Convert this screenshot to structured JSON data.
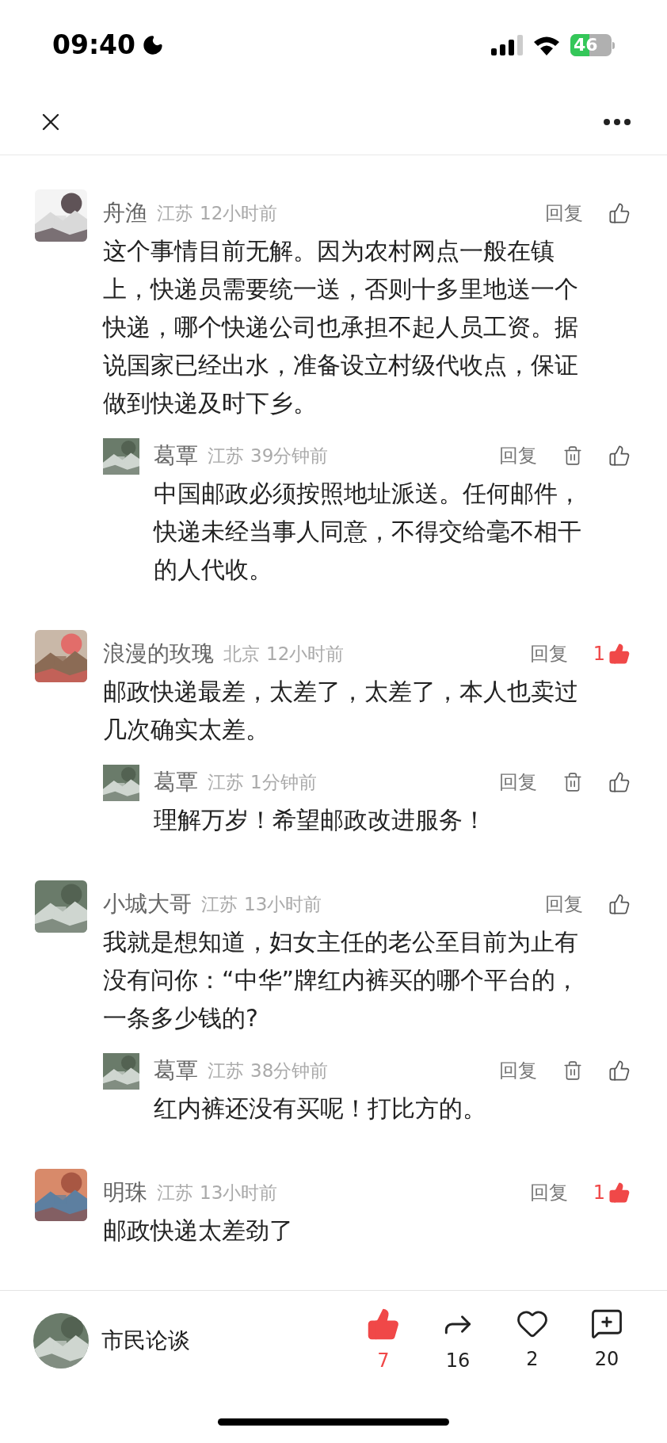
{
  "status_bar": {
    "time": "09:40",
    "battery": "46"
  },
  "comments": [
    {
      "name": "舟渔",
      "location": "江苏",
      "time": "12小时前",
      "reply_label": "回复",
      "deletable": false,
      "like": {
        "liked": false
      },
      "text": "这个事情目前无解。因为农村网点一般在镇上，快递员需要统一送，否则十多里地送一个快递，哪个快递公司也承担不起人员工资。据说国家已经出水，准备设立村级代收点，保证做到快递及时下乡。",
      "replies": [
        {
          "name": "葛覃",
          "location": "江苏",
          "time": "39分钟前",
          "reply_label": "回复",
          "deletable": true,
          "like": {
            "liked": false
          },
          "text": "中国邮政必须按照地址派送。任何邮件，快递未经当事人同意，不得交给毫不相干的人代收。"
        }
      ]
    },
    {
      "name": "浪漫的玫瑰",
      "location": "北京",
      "time": "12小时前",
      "reply_label": "回复",
      "deletable": false,
      "like": {
        "liked": true,
        "count": "1"
      },
      "text": "邮政快递最差，太差了，太差了，本人也卖过几次确实太差。",
      "replies": [
        {
          "name": "葛覃",
          "location": "江苏",
          "time": "1分钟前",
          "reply_label": "回复",
          "deletable": true,
          "like": {
            "liked": false
          },
          "text": "理解万岁！希望邮政改进服务！"
        }
      ]
    },
    {
      "name": "小城大哥",
      "location": "江苏",
      "time": "13小时前",
      "reply_label": "回复",
      "deletable": false,
      "like": {
        "liked": false
      },
      "text": "我就是想知道，妇女主任的老公至目前为止有没有问你：“中华”牌红内裤买的哪个平台的，一条多少钱的?",
      "replies": [
        {
          "name": "葛覃",
          "location": "江苏",
          "time": "38分钟前",
          "reply_label": "回复",
          "deletable": true,
          "like": {
            "liked": false
          },
          "text": "红内裤还没有买呢！打比方的。"
        }
      ]
    },
    {
      "name": "明珠",
      "location": "江苏",
      "time": "13小时前",
      "reply_label": "回复",
      "deletable": false,
      "like": {
        "liked": true,
        "count": "1"
      },
      "text": "邮政快递太差劲了"
    }
  ],
  "footer": {
    "name": "市民论谈",
    "actions": [
      {
        "kind": "like",
        "count": "7",
        "active": true
      },
      {
        "kind": "share",
        "count": "16",
        "active": false
      },
      {
        "kind": "favorite",
        "count": "2",
        "active": false
      },
      {
        "kind": "comment",
        "count": "20",
        "active": false
      }
    ]
  }
}
